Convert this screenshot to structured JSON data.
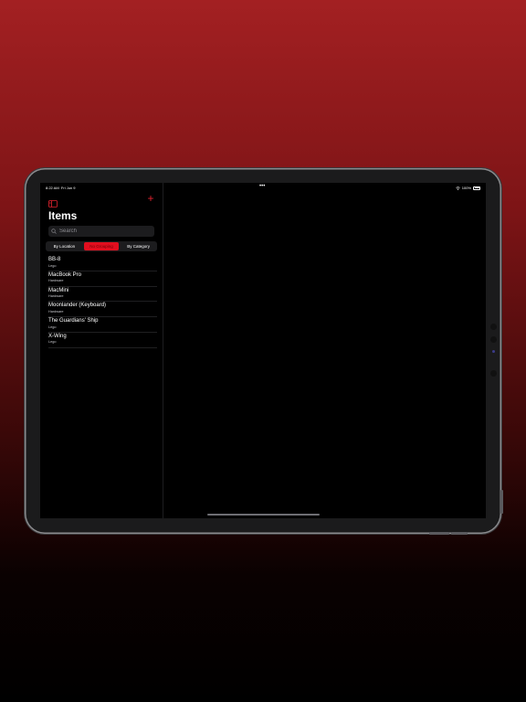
{
  "status_bar": {
    "time": "8:22 AM",
    "date": "Fri Jun 9",
    "dots": "•••",
    "battery": "100%"
  },
  "sidebar": {
    "title": "Items",
    "search_placeholder": "Search",
    "segments": [
      {
        "label": "By Location",
        "selected": false
      },
      {
        "label": "No Grouping",
        "selected": true
      },
      {
        "label": "By Category",
        "selected": false
      }
    ],
    "items": [
      {
        "title": "BB-8",
        "subtitle": "Lego"
      },
      {
        "title": "MacBook Pro",
        "subtitle": "Hardware"
      },
      {
        "title": "MacMini",
        "subtitle": "Hardware"
      },
      {
        "title": "Moonlander (Keyboard)",
        "subtitle": "Hardware"
      },
      {
        "title": "The Guardians' Ship",
        "subtitle": "Lego"
      },
      {
        "title": "X-Wing",
        "subtitle": "Lego"
      }
    ]
  },
  "colors": {
    "accent": "#e10e1e",
    "background_top": "#a32022",
    "background_bottom": "#000000"
  },
  "icons": {
    "toggle": "sidebar-toggle-icon",
    "add": "plus-icon",
    "search": "search-icon",
    "wifi": "wifi-icon",
    "battery": "battery-icon"
  }
}
